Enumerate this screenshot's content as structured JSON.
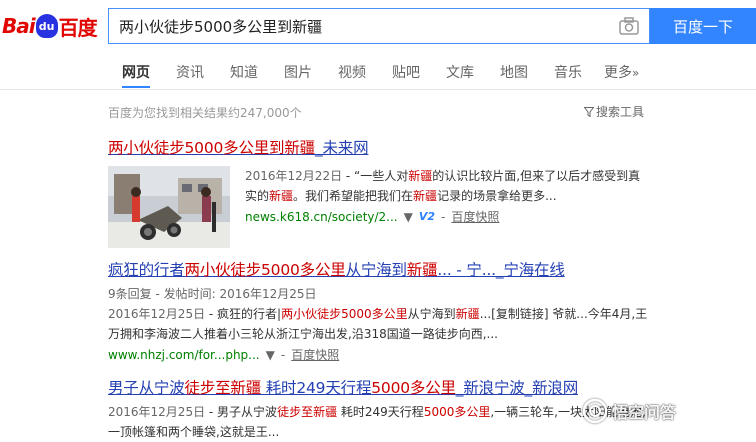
{
  "logo": {
    "bai": "Bai",
    "du": "du",
    "brand": "百度"
  },
  "search": {
    "query": "两小伙徒步5000多公里到新疆",
    "button_label": "百度一下"
  },
  "tabs": [
    {
      "label": "网页",
      "active": true
    },
    {
      "label": "资讯"
    },
    {
      "label": "知道"
    },
    {
      "label": "图片"
    },
    {
      "label": "视频"
    },
    {
      "label": "贴吧"
    },
    {
      "label": "文库"
    },
    {
      "label": "地图"
    },
    {
      "label": "音乐"
    },
    {
      "label": "更多",
      "suffix": "»"
    }
  ],
  "stats": "百度为您找到相关结果约247,000个",
  "search_tools_label": "搜索工具",
  "results": [
    {
      "title_parts": [
        "两小伙徒步5000多公里到新疆",
        "_未来网"
      ],
      "date": "2016年12月22日",
      "abstract_parts": [
        " - “一些人对",
        "新疆",
        "的认识比较片面,但来了以后才感受到真实的",
        "新疆",
        "。我们希望能把我们在",
        "新疆",
        "记录的场景拿给更多..."
      ],
      "url": "news.k618.cn/society/2...",
      "badge": "V2",
      "snapshot": "百度快照"
    },
    {
      "title_parts": [
        "疯狂的行者",
        "两小伙徒步5000多公里",
        "从宁海到",
        "新疆",
        "... - 宁..._宁海在线"
      ],
      "meta": "9条回复 - 发帖时间: 2016年12月25日",
      "date": "2016年12月25日",
      "abstract_parts": [
        " - 疯狂的行者|",
        "两小伙徒步5000多公里",
        "从宁海到",
        "新疆",
        "...[复制链接] 爷就...今年4月,王万拥和李海波二人推着小三轮从浙江宁海出发,沿318国道一路徒步向西,..."
      ],
      "url": "www.nhzj.com/for...php...",
      "snapshot": "百度快照"
    },
    {
      "title_parts": [
        "男子从宁波",
        "徒步至新疆",
        " 耗时249天行程",
        "5000多公里",
        "_新浪宁波_新浪网"
      ],
      "date": "2016年12月25日",
      "abstract_parts": [
        " - 男子从宁波",
        "徒步至新疆",
        " 耗时249天行程",
        "5000多公里",
        ",一辆三轮车,一块太阳能电池,一顶帐篷和两个睡袋,这就是王..."
      ]
    }
  ],
  "watermark": "悟空问答",
  "colors": {
    "link": "#2440b3",
    "highlight": "#cc0000",
    "url": "#008000",
    "button": "#3385ff",
    "logo_red": "#e10602",
    "logo_blue": "#2932e1"
  }
}
